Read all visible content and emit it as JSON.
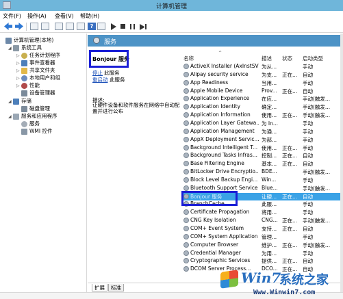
{
  "window": {
    "title": "计算机管理"
  },
  "menu": [
    "文件(F)",
    "操作(A)",
    "查看(V)",
    "帮助(H)"
  ],
  "toolbar_icons": [
    "back-icon",
    "forward-icon",
    "up-icon",
    "show-tree-icon",
    "refresh-icon",
    "export-icon",
    "properties-icon",
    "help-icon",
    "view-icon",
    "start-service-icon",
    "stop-service-icon",
    "pause-service-icon",
    "restart-service-icon"
  ],
  "tree": [
    {
      "label": "计算机管理(本地)",
      "icon": "computer-icon",
      "level": 0,
      "exp": ""
    },
    {
      "label": "系统工具",
      "icon": "tools-icon",
      "level": 1,
      "exp": "◢"
    },
    {
      "label": "任务计划程序",
      "icon": "clock-icon",
      "level": 2,
      "exp": "▷"
    },
    {
      "label": "事件查看器",
      "icon": "event-icon",
      "level": 2,
      "exp": "▷"
    },
    {
      "label": "共享文件夹",
      "icon": "folder-icon",
      "level": 2,
      "exp": "▷"
    },
    {
      "label": "本地用户和组",
      "icon": "users-icon",
      "level": 2,
      "exp": "▷"
    },
    {
      "label": "性能",
      "icon": "performance-icon",
      "level": 2,
      "exp": "▷"
    },
    {
      "label": "设备管理器",
      "icon": "device-icon",
      "level": 2,
      "exp": ""
    },
    {
      "label": "存储",
      "icon": "storage-icon",
      "level": 1,
      "exp": "◢"
    },
    {
      "label": "磁盘管理",
      "icon": "disk-icon",
      "level": 2,
      "exp": ""
    },
    {
      "label": "服务和应用程序",
      "icon": "services-apps-icon",
      "level": 1,
      "exp": "◢"
    },
    {
      "label": "服务",
      "icon": "gear-icon",
      "level": 2,
      "exp": ""
    },
    {
      "label": "WMI 控件",
      "icon": "wmi-icon",
      "level": 2,
      "exp": ""
    }
  ],
  "header": {
    "title": "服务"
  },
  "detail": {
    "service_name": "Bonjour 服务",
    "stop_link": "停止",
    "stop_rest": "此服务",
    "restart_link": "重启动",
    "restart_rest": "此服务",
    "desc_label": "描述:",
    "desc_text": "让硬件设备和软件服务在网络中自动配置并进行公布"
  },
  "columns": {
    "name": "名称",
    "desc": "描述",
    "status": "状态",
    "startup": "启动类型"
  },
  "services": [
    {
      "name": "ActiveX Installer (AxInstSV)",
      "desc": "为从...",
      "status": "",
      "startup": "手动"
    },
    {
      "name": "Alipay security service",
      "desc": "为支...",
      "status": "正在...",
      "startup": "自动"
    },
    {
      "name": "App Readiness",
      "desc": "当用...",
      "status": "",
      "startup": "手动"
    },
    {
      "name": "Apple Mobile Device",
      "desc": "Prov...",
      "status": "正在...",
      "startup": "自动"
    },
    {
      "name": "Application Experience",
      "desc": "在应...",
      "status": "",
      "startup": "手动(触发..."
    },
    {
      "name": "Application Identity",
      "desc": "确定...",
      "status": "",
      "startup": "手动(触发..."
    },
    {
      "name": "Application Information",
      "desc": "使用...",
      "status": "正在...",
      "startup": "手动(触发..."
    },
    {
      "name": "Application Layer Gatewa...",
      "desc": "为 In...",
      "status": "",
      "startup": "手动"
    },
    {
      "name": "Application Management",
      "desc": "为通...",
      "status": "",
      "startup": "手动"
    },
    {
      "name": "AppX Deployment Servic...",
      "desc": "为部...",
      "status": "",
      "startup": "手动"
    },
    {
      "name": "Background Intelligent T...",
      "desc": "使用...",
      "status": "正在...",
      "startup": "手动"
    },
    {
      "name": "Background Tasks Infras...",
      "desc": "控制...",
      "status": "正在...",
      "startup": "自动"
    },
    {
      "name": "Base Filtering Engine",
      "desc": "基本...",
      "status": "正在...",
      "startup": "自动"
    },
    {
      "name": "BitLocker Drive Encryptio...",
      "desc": "BDE...",
      "status": "",
      "startup": "手动(触发..."
    },
    {
      "name": "Block Level Backup Engi...",
      "desc": "Win...",
      "status": "",
      "startup": "手动"
    },
    {
      "name": "Bluetooth Support Service",
      "desc": "Blue...",
      "status": "",
      "startup": "手动(触发..."
    },
    {
      "name": "Bonjour 服务",
      "desc": "让硬...",
      "status": "正在...",
      "startup": "自动",
      "selected": true
    },
    {
      "name": "BranchCache",
      "desc": "此服...",
      "status": "",
      "startup": "手动"
    },
    {
      "name": "Certificate Propagation",
      "desc": "将用...",
      "status": "",
      "startup": "手动"
    },
    {
      "name": "CNG Key Isolation",
      "desc": "CNG...",
      "status": "正在...",
      "startup": "手动(触发..."
    },
    {
      "name": "COM+ Event System",
      "desc": "支持...",
      "status": "正在...",
      "startup": "自动"
    },
    {
      "name": "COM+ System Application",
      "desc": "管理...",
      "status": "",
      "startup": "手动"
    },
    {
      "name": "Computer Browser",
      "desc": "维护...",
      "status": "正在...",
      "startup": "手动(触发..."
    },
    {
      "name": "Credential Manager",
      "desc": "为用...",
      "status": "",
      "startup": "手动"
    },
    {
      "name": "Cryptographic Services",
      "desc": "提供...",
      "status": "正在...",
      "startup": "自动"
    },
    {
      "name": "DCOM Server Process...",
      "desc": "DCO...",
      "status": "正在...",
      "startup": "自动"
    }
  ],
  "tabs": [
    "扩展",
    "标准"
  ],
  "watermark": {
    "brand": "Win7",
    "brand2": "系统之家",
    "url": "Www.Winwin7.com"
  }
}
